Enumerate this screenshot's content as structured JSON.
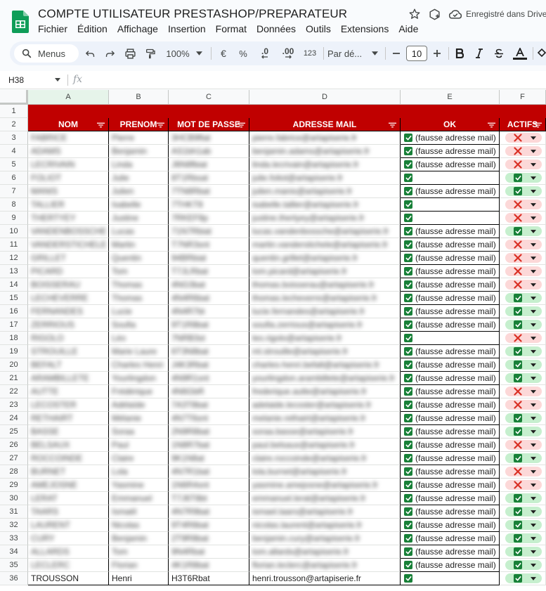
{
  "app": {
    "title": "COMPTE UTILISATEUR PRESTASHOP/PREPARATEUR",
    "saved_status": "Enregistré dans Drive",
    "menu": [
      "Fichier",
      "Édition",
      "Affichage",
      "Insertion",
      "Format",
      "Données",
      "Outils",
      "Extensions",
      "Aide"
    ]
  },
  "toolbar": {
    "menus_label": "Menus",
    "zoom": "100%",
    "currency": "€",
    "percent": "%",
    "decrease_decimals": ".0",
    "increase_decimals": ".00",
    "number_format": "123",
    "font": "Par dé...",
    "font_size": "10"
  },
  "formula_bar": {
    "cell_ref": "H38",
    "fx": "fx",
    "content": ""
  },
  "colors": {
    "header_red": "#c00000",
    "check_green": "#188038",
    "chip_green": "#c6efce",
    "chip_red": "#fcd8d8",
    "x_red": "#d93025"
  },
  "sheet": {
    "columns": [
      "A",
      "B",
      "C",
      "D",
      "E",
      "F"
    ],
    "headers": [
      "NOM",
      "PRENOM",
      "MOT DE PASSE",
      "ADRESSE MAIL",
      "OK",
      "ACTIFS"
    ],
    "ok_text": "(fausse adresse mail)",
    "rows": [
      {
        "n": "3",
        "nom": "FABRICE",
        "prenom": "Pierre",
        "mdp": "3HCB9ftat",
        "mail": "pierre.fabrice@artapiserie.fr",
        "ok": true,
        "actif": false
      },
      {
        "n": "4",
        "nom": "ADAMS",
        "prenom": "Benjamin",
        "mdp": "AS1bh1ab",
        "mail": "benjamin.adams@artapiserie.fr",
        "ok": true,
        "actif": false
      },
      {
        "n": "5",
        "nom": "LECRIVAIN",
        "prenom": "Linda",
        "mdp": "J6N8fbiat",
        "mail": "linda.lecrivain@artapiserie.fr",
        "ok": true,
        "actif": false
      },
      {
        "n": "6",
        "nom": "FOLIOT",
        "prenom": "Julie",
        "mdp": "8T1Rbsat",
        "mail": "julie.foliot@artapiserie.fr",
        "ok": false,
        "actif": true
      },
      {
        "n": "7",
        "nom": "MANIS",
        "prenom": "Julien",
        "mdp": "7TN8Rbat",
        "mail": "julien.manis@artapiserie.fr",
        "ok": true,
        "actif": true
      },
      {
        "n": "8",
        "nom": "TALLIER",
        "prenom": "Isabelle",
        "mdp": "7THKT8",
        "mail": "isabelle.tallier@artapiserie.fr",
        "ok": false,
        "actif": false
      },
      {
        "n": "9",
        "nom": "THERTYEY",
        "prenom": "Justine",
        "mdp": "7RKEF8p",
        "mail": "justine.thertyey@artapiserie.fr",
        "ok": false,
        "actif": false
      },
      {
        "n": "10",
        "nom": "VANDENBOSSCHE",
        "prenom": "Lucas",
        "mdp": "71N7Rbiat",
        "mail": "lucas.vandenbossche@artapiserie.fr",
        "ok": true,
        "actif": true
      },
      {
        "n": "11",
        "nom": "VANDERSTICHELE",
        "prenom": "Martin",
        "mdp": "T7NR3snt",
        "mail": "martin.vanderstichele@artapiserie.fr",
        "ok": true,
        "actif": false
      },
      {
        "n": "12",
        "nom": "GRILLET",
        "prenom": "Quentin",
        "mdp": "94BRbiat",
        "mail": "quentin.grillet@artapiserie.fr",
        "ok": true,
        "actif": false
      },
      {
        "n": "13",
        "nom": "PICARD",
        "prenom": "Tom",
        "mdp": "T7JLRbat",
        "mail": "tom.picard@artapiserie.fr",
        "ok": true,
        "actif": false
      },
      {
        "n": "14",
        "nom": "BOISSERAU",
        "prenom": "Thomas",
        "mdp": "4NG3bat",
        "mail": "thomas.boisserau@artapiserie.fr",
        "ok": true,
        "actif": false
      },
      {
        "n": "15",
        "nom": "LECHEVERRE",
        "prenom": "Thomas",
        "mdp": "4N4R6bat",
        "mail": "thomas.lecheverre@artapiserie.fr",
        "ok": true,
        "actif": true
      },
      {
        "n": "16",
        "nom": "FERNANDES",
        "prenom": "Lucie",
        "mdp": "4N4R7bt",
        "mail": "lucie.fernandes@artapiserie.fr",
        "ok": true,
        "actif": true
      },
      {
        "n": "17",
        "nom": "ZERRIOUS",
        "prenom": "Soufia",
        "mdp": "9T1R8bat",
        "mail": "soufia.zerrious@artapiserie.fr",
        "ok": true,
        "actif": true
      },
      {
        "n": "18",
        "nom": "RIGOLO",
        "prenom": "Léo",
        "mdp": "7NRB3st",
        "mail": "leo.rigolo@artapiserie.fr",
        "ok": false,
        "actif": false
      },
      {
        "n": "19",
        "nom": "STROUILLE",
        "prenom": "Marie Laure",
        "mdp": "6T3N8bat",
        "mail": "ml.strouille@artapiserie.fr",
        "ok": true,
        "actif": true
      },
      {
        "n": "20",
        "nom": "BEFALT",
        "prenom": "Charles Henri",
        "mdp": "J4K3Rbat",
        "mail": "charles-henri.befalt@artapiserie.fr",
        "ok": true,
        "actif": true
      },
      {
        "n": "21",
        "nom": "ARAMBILLETE",
        "prenom": "Yourlingdon",
        "mdp": "4N9R1snt",
        "mail": "yourlingdon.arambillete@artapiserie.fr",
        "ok": true,
        "actif": true
      },
      {
        "n": "22",
        "nom": "AUTTE",
        "prenom": "Frédérique",
        "mdp": "4N6GbR",
        "mail": "frederique.autte@artapiserie.fr",
        "ok": true,
        "actif": false
      },
      {
        "n": "23",
        "nom": "LECOSTER",
        "prenom": "Adélaïde",
        "mdp": "7A3T8bat",
        "mail": "adelaide.lecoster@artapiserie.fr",
        "ok": true,
        "actif": false
      },
      {
        "n": "24",
        "nom": "RETHAIRT",
        "prenom": "Mélanie",
        "mdp": "4N7T6snt",
        "mail": "melanie.rethairt@artapiserie.fr",
        "ok": true,
        "actif": true
      },
      {
        "n": "25",
        "nom": "BASSE",
        "prenom": "Soraa",
        "mdp": "2N9R8bat",
        "mail": "soraa.basse@artapiserie.fr",
        "ok": true,
        "actif": true
      },
      {
        "n": "26",
        "nom": "BELSAUX",
        "prenom": "Paul",
        "mdp": "1N8R7bat",
        "mail": "paul.belsaux@artapiserie.fr",
        "ok": true,
        "actif": false
      },
      {
        "n": "27",
        "nom": "ROCCOINDE",
        "prenom": "Claire",
        "mdp": "9K1N8at",
        "mail": "claire.roccoinde@artapiserie.fr",
        "ok": true,
        "actif": true
      },
      {
        "n": "28",
        "nom": "BURNET",
        "prenom": "Lola",
        "mdp": "4N7R1bat",
        "mail": "lola.burnet@artapiserie.fr",
        "ok": true,
        "actif": false
      },
      {
        "n": "29",
        "nom": "AMEJOSNE",
        "prenom": "Yasmine",
        "mdp": "1N6R4snt",
        "mail": "yasmine.amejosne@artapiserie.fr",
        "ok": true,
        "actif": false
      },
      {
        "n": "30",
        "nom": "LERAT",
        "prenom": "Emmanuel",
        "mdp": "T7J6T8bt",
        "mail": "emmanuel.lerat@artapiserie.fr",
        "ok": true,
        "actif": true
      },
      {
        "n": "31",
        "nom": "TAARS",
        "prenom": "Ismaël",
        "mdp": "4N7R9bat",
        "mail": "ismael.taars@artapiserie.fr",
        "ok": true,
        "actif": true
      },
      {
        "n": "32",
        "nom": "LAURENT",
        "prenom": "Nicolas",
        "mdp": "9T4R6bat",
        "mail": "nicolas.laurent@artapiserie.fr",
        "ok": true,
        "actif": true
      },
      {
        "n": "33",
        "nom": "CURY",
        "prenom": "Benjamin",
        "mdp": "2T9R8bat",
        "mail": "benjamin.cury@artapiserie.fr",
        "ok": true,
        "actif": true
      },
      {
        "n": "34",
        "nom": "ALLARDS",
        "prenom": "Tom",
        "mdp": "9N4Rbat",
        "mail": "tom.allards@artapiserie.fr",
        "ok": true,
        "actif": true
      },
      {
        "n": "35",
        "nom": "LECLERC",
        "prenom": "Florian",
        "mdp": "4K1R8bat",
        "mail": "florian.leclerc@artapiserie.fr",
        "ok": true,
        "actif": true
      },
      {
        "n": "36",
        "nom": "TROUSSON",
        "prenom": "Henri",
        "mdp": "H3T6Rbat",
        "mail": "henri.trousson@artapiserie.fr",
        "ok": false,
        "actif": true,
        "visible": true
      }
    ]
  }
}
